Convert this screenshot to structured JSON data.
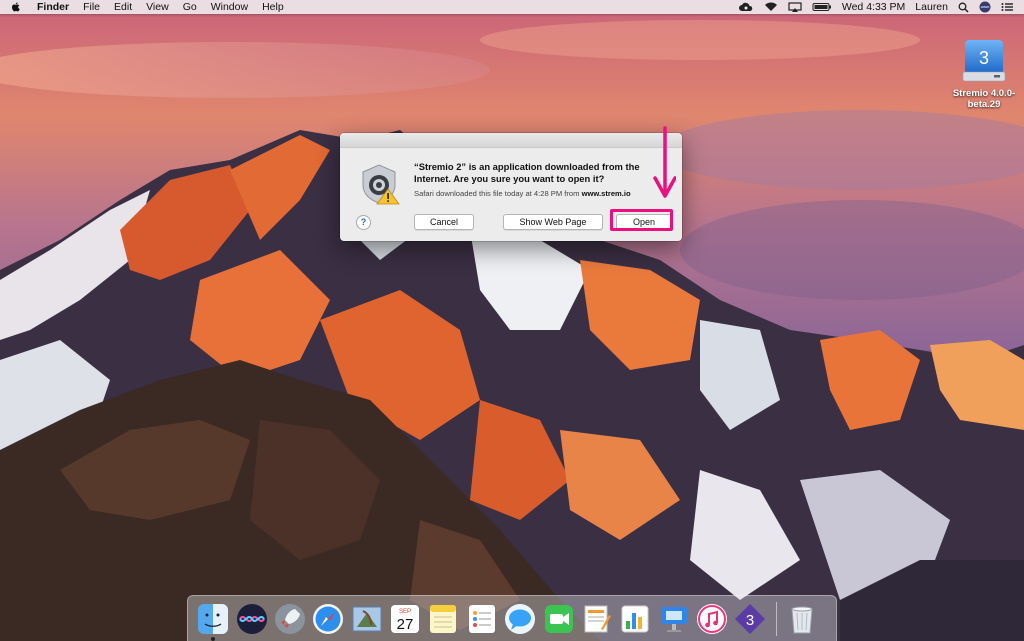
{
  "menubar": {
    "app_name": "Finder",
    "menus": [
      "File",
      "Edit",
      "View",
      "Go",
      "Window",
      "Help"
    ],
    "clock": "Wed 4:33 PM",
    "user": "Lauren",
    "icons": [
      "apple-icon",
      "creative-cloud-icon",
      "wifi-icon",
      "airplay-icon",
      "battery-icon",
      "search-icon",
      "siri-icon",
      "notification-center-icon"
    ]
  },
  "desktop": {
    "drive_label_line1": "Stremio 4.0.0-",
    "drive_label_line2": "beta.29",
    "drive_glyph": "3"
  },
  "dialog": {
    "title_line1": "“Stremio 2” is an application downloaded from the",
    "title_line2": "Internet. Are you sure you want to open it?",
    "sub_prefix": "Safari downloaded this file today at 4:28 PM from ",
    "sub_source": "www.strem.io",
    "help_label": "?",
    "cancel_label": "Cancel",
    "show_web_page_label": "Show Web Page",
    "open_label": "Open"
  },
  "annotation": {
    "color": "#ec0f7e"
  },
  "dock": {
    "apps": [
      "finder",
      "siri",
      "launchpad",
      "safari",
      "mail",
      "calendar",
      "notes",
      "reminders",
      "messages",
      "facetime",
      "pages",
      "numbers",
      "keynote",
      "itunes",
      "stremio",
      "trash"
    ],
    "calendar_month": "SEP",
    "calendar_day": "27",
    "stremio_glyph": "3"
  }
}
